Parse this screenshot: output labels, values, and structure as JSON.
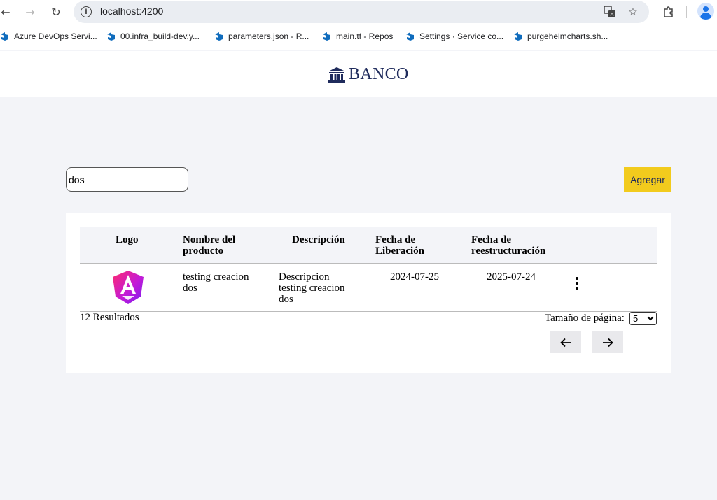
{
  "browser": {
    "url": "localhost:4200",
    "bookmarks": [
      {
        "label": "Azure DevOps Servi..."
      },
      {
        "label": "00.infra_build-dev.y..."
      },
      {
        "label": "parameters.json - R..."
      },
      {
        "label": "main.tf - Repos"
      },
      {
        "label": "Settings · Service co..."
      },
      {
        "label": "purgehelmcharts.sh..."
      }
    ]
  },
  "app": {
    "brand": "BANCO",
    "search": {
      "value": "dos"
    },
    "add_label": "Agregar",
    "table": {
      "headers": {
        "logo": "Logo",
        "name_l1": "Nombre del",
        "name_l2": "producto",
        "description": "Descripción",
        "release_l1": "Fecha de",
        "release_l2": "Liberación",
        "restructure_l1": "Fecha de",
        "restructure_l2": "reestructuración"
      },
      "rows": [
        {
          "name_l1": "testing creacion",
          "name_l2": "dos",
          "desc_l1": "Descripcion",
          "desc_l2": "testing creacion",
          "desc_l3": "dos",
          "release_date": "2024-07-25",
          "restructure_date": "2025-07-24"
        }
      ]
    },
    "results_text": "12 Resultados",
    "page_size_label": "Tamaño de página:",
    "page_size_value": "5",
    "page_size_options": [
      "5"
    ]
  },
  "colors": {
    "accent": "#f2cb1d",
    "brand": "#1f2b5c",
    "background": "#f3f4f8"
  }
}
